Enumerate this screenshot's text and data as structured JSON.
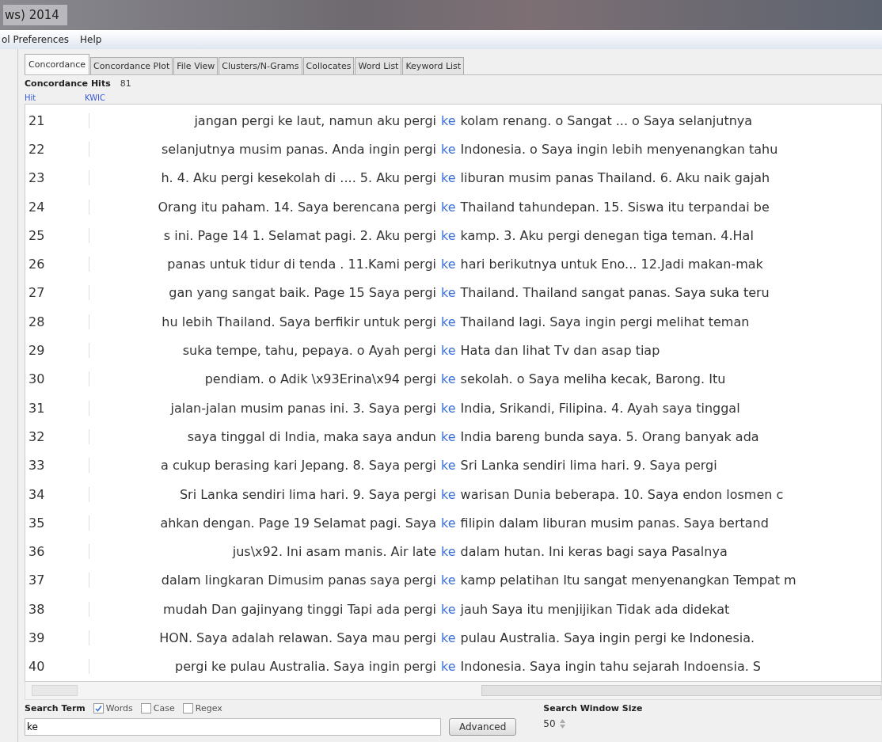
{
  "window": {
    "title": "ws) 2014"
  },
  "menu": [
    "ol Preferences",
    "Help"
  ],
  "tabs": [
    {
      "label": "Concordance",
      "selected": true
    },
    {
      "label": "Concordance Plot",
      "selected": false
    },
    {
      "label": "File View",
      "selected": false
    },
    {
      "label": "Clusters/N-Grams",
      "selected": false
    },
    {
      "label": "Collocates",
      "selected": false
    },
    {
      "label": "Word List",
      "selected": false
    },
    {
      "label": "Keyword List",
      "selected": false
    }
  ],
  "hits": {
    "label": "Concordance Hits",
    "count": "81"
  },
  "table": {
    "columns": [
      "Hit",
      "KWIC"
    ],
    "rows": [
      {
        "hit": "21",
        "left": "jangan pergi ke laut, namun aku pergi",
        "keyword": "ke",
        "right": "kolam renang. o Sangat ... o Saya selanjutnya"
      },
      {
        "hit": "22",
        "left": "selanjutnya musim panas. Anda ingin pergi",
        "keyword": "ke",
        "right": "Indonesia. o Saya ingin lebih menyenangkan tahu"
      },
      {
        "hit": "23",
        "left": "h.   4. Aku pergi kesekolah di .... 5. Aku pergi",
        "keyword": "ke",
        "right": "liburan musim panas Thailand. 6. Aku naik gajah"
      },
      {
        "hit": "24",
        "left": "Orang itu paham. 14. Saya berencana pergi",
        "keyword": "ke",
        "right": "Thailand tahundepan. 15. Siswa itu terpandai be"
      },
      {
        "hit": "25",
        "left": "s ini.   Page 14 1. Selamat pagi. 2. Aku pergi",
        "keyword": "ke",
        "right": "kamp. 3. Aku pergi denegan tiga teman. 4.Hal"
      },
      {
        "hit": "26",
        "left": "panas untuk tidur di tenda . 11.Kami pergi",
        "keyword": "ke",
        "right": "hari berikutnya untuk  Eno... 12.Jadi makan-mak"
      },
      {
        "hit": "27",
        "left": "gan yang sangat baik.    Page 15 Saya pergi",
        "keyword": "ke",
        "right": "Thailand. Thailand sangat panas. Saya suka teru"
      },
      {
        "hit": "28",
        "left": "hu lebih Thailand. Saya berfikir untuk pergi",
        "keyword": "ke",
        "right": "Thailand lagi. Saya ingin pergi melihat teman"
      },
      {
        "hit": "29",
        "left": "suka tempe, tahu, pepaya. o Ayah pergi",
        "keyword": "ke",
        "right": "Hata dan lihat Tv dan asap tiap"
      },
      {
        "hit": "30",
        "left": "pendiam. o Adik \\x93Erina\\x94 pergi",
        "keyword": "ke",
        "right": "sekolah. o Saya meliha kecak, Barong. Itu"
      },
      {
        "hit": "31",
        "left": "jalan-jalan musim panas ini. 3. Saya pergi",
        "keyword": "ke",
        "right": "India, Srikandi, Filipina. 4. Ayah saya tinggal"
      },
      {
        "hit": "32",
        "left": "saya tinggal di India, maka saya andun",
        "keyword": "ke",
        "right": "India bareng bunda saya. 5. Orang banyak ada"
      },
      {
        "hit": "33",
        "left": "a cukup berasing kari Jepang. 8. Saya pergi",
        "keyword": "ke",
        "right": "Sri Lanka sendiri lima hari. 9. Saya pergi"
      },
      {
        "hit": "34",
        "left": "Sri Lanka sendiri lima hari. 9. Saya pergi",
        "keyword": "ke",
        "right": "warisan Dunia beberapa. 10. Saya endon losmen c"
      },
      {
        "hit": "35",
        "left": "ahkan dengan.  Page 19 Selamat pagi. Saya",
        "keyword": "ke",
        "right": "filipin dalam liburan musim panas. Saya bertand"
      },
      {
        "hit": "36",
        "left": "jus\\x92. Ini asam manis. Air late",
        "keyword": "ke",
        "right": "dalam hutan.  Ini keras bagi saya  Pasalnya"
      },
      {
        "hit": "37",
        "left": "dalam lingkaran Dimusim panas saya pergi",
        "keyword": "ke",
        "right": "kamp pelatihan Itu sangat menyenangkan Tempat m"
      },
      {
        "hit": "38",
        "left": "mudah Dan gajinyang tinggi Tapi ada pergi",
        "keyword": "ke",
        "right": "jauh Saya itu menjijikan Tidak ada didekat"
      },
      {
        "hit": "39",
        "left": "HON. Saya adalah relawan. Saya mau pergi",
        "keyword": "ke",
        "right": "pulau Australia. Saya ingin pergi ke Indonesia."
      },
      {
        "hit": "40",
        "left": "pergi ke pulau Australia. Saya ingin pergi",
        "keyword": "ke",
        "right": "Indonesia. Saya ingin tahu sejarah Indoensia. S"
      }
    ]
  },
  "search": {
    "label": "Search Term",
    "options": [
      {
        "label": "Words",
        "checked": true
      },
      {
        "label": "Case",
        "checked": false
      },
      {
        "label": "Regex",
        "checked": false
      }
    ],
    "value": "ke",
    "advanced": "Advanced"
  },
  "window_size": {
    "label": "Search Window Size",
    "value": "50"
  }
}
